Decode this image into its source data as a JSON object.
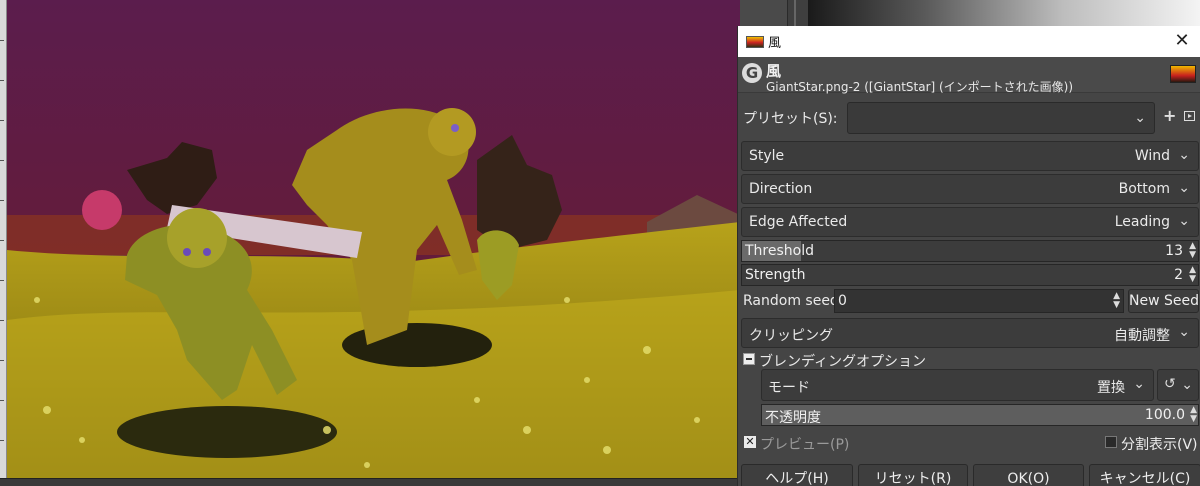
{
  "dialog": {
    "window_title": "風",
    "header_title": "風",
    "header_subtitle": "GiantStar.png-2 ([GiantStar] (インポートされた画像))",
    "presets_label": "プリセット(S):",
    "presets_value": "",
    "style": {
      "label": "Style",
      "value": "Wind"
    },
    "direction": {
      "label": "Direction",
      "value": "Bottom"
    },
    "edge": {
      "label": "Edge Affected",
      "value": "Leading"
    },
    "threshold": {
      "label": "Threshold",
      "value": "13",
      "fraction": 0.13
    },
    "strength": {
      "label": "Strength",
      "value": "2"
    },
    "random_seed": {
      "label": "Random seed",
      "value": "0",
      "button": "New Seed"
    },
    "clipping": {
      "label": "クリッピング",
      "value": "自動調整"
    },
    "blending_options_label": "ブレンディングオプション",
    "mode": {
      "label": "モード",
      "value": "置換"
    },
    "opacity": {
      "label": "不透明度",
      "value": "100.0"
    },
    "preview_label": "プレビュー(P)",
    "preview_checked": true,
    "split_view_label": "分割表示(V)",
    "split_view_checked": false,
    "buttons": {
      "help": "ヘルプ(H)",
      "reset": "リセット(R)",
      "ok": "OK(O)",
      "cancel": "キャンセル(C)"
    }
  },
  "icons": {
    "close": "close-icon",
    "gimp": "gimp-logo-icon",
    "chevron": "chevron-down-icon",
    "add": "plus-icon",
    "menu": "presets-menu-icon",
    "composite": "composite-mode-icon"
  },
  "colors": {
    "dialog_bg": "#454545",
    "titlebar_bg": "#ffffff",
    "canvas_sky_top": "#5a1f4a",
    "canvas_ground": "#c9b21d"
  }
}
